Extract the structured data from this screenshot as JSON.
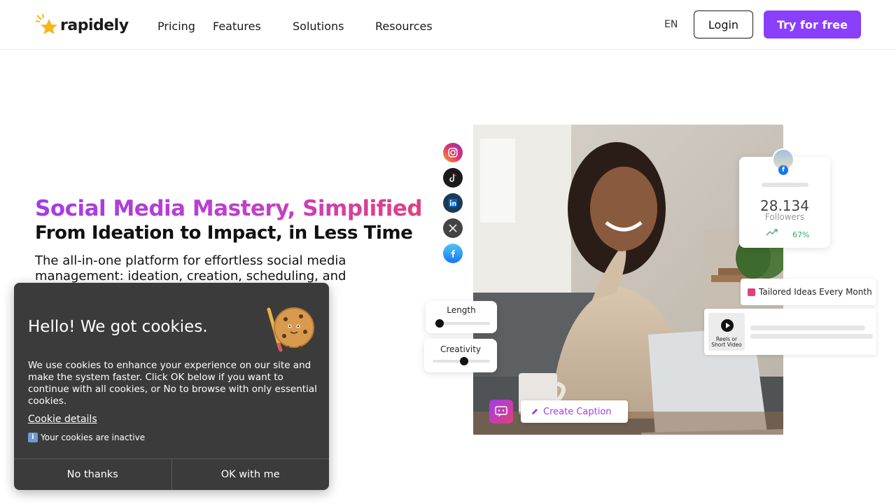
{
  "nav": {
    "logo_text": "rapidely",
    "links": [
      "Pricing",
      "Features",
      "Solutions",
      "Resources"
    ],
    "lang": "EN",
    "login": "Login",
    "try": "Try for free"
  },
  "hero": {
    "headline": "Social Media Mastery, Simplified",
    "subheadline": "From Ideation to Impact, in Less Time",
    "description": "The all-in-one platform for effortless social media management: ideation, creation, scheduling, and"
  },
  "visual": {
    "social_icons": [
      "instagram-icon",
      "tiktok-icon",
      "linkedin-icon",
      "x-icon",
      "facebook-icon"
    ],
    "followers_count": "28.134",
    "followers_label": "Followers",
    "followers_growth": "67%",
    "slider_length_label": "Length",
    "slider_length_value": 0.1,
    "slider_creativity_label": "Creativity",
    "slider_creativity_value": 0.55,
    "ideas_label": "Tailored Ideas Every Month",
    "reels_label_1": "Reels or",
    "reels_label_2": "Short Video",
    "caption_button": "Create Caption",
    "accent_color": "#8a3ffc",
    "gradient_start": "#a33ce6",
    "gradient_end": "#e0407e"
  },
  "cookie": {
    "title": "Hello! We got cookies.",
    "body": "We use cookies to enhance your experience on our site and make the system faster. Click OK below if you want to continue with all cookies, or No to browse with only essential cookies.",
    "details_link": "Cookie details",
    "status": "Your cookies are inactive",
    "no_button": "No thanks",
    "ok_button": "OK with me"
  }
}
